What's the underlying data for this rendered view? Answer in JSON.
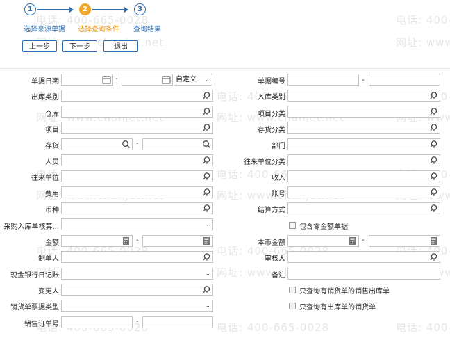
{
  "watermark": {
    "phone": "电话: 400-665-0028",
    "site": "网址: www.chanjet.net"
  },
  "wizard": {
    "steps": [
      {
        "num": "1",
        "label": "选择来源单据"
      },
      {
        "num": "2",
        "label": "选择查询条件"
      },
      {
        "num": "3",
        "label": "查询结果"
      }
    ],
    "active_step": 2
  },
  "buttons": {
    "prev": "上一步",
    "next": "下一步",
    "exit": "退出"
  },
  "form": {
    "left": {
      "doc_date": "单据日期",
      "dash": "-",
      "date_mode": "自定义",
      "out_type": "出库类别",
      "warehouse": "仓库",
      "project": "项目",
      "inventory": "存货",
      "person": "人员",
      "partner": "往来单位",
      "expense": "费用",
      "currency": "币种",
      "purchase_account": "采购入库单核算...",
      "amount": "金额",
      "maker": "制单人",
      "cash_bank": "现金银行日记账",
      "changer": "变更人",
      "sales_type": "销货单票据类型",
      "sales_order_no": "销售订单号"
    },
    "right": {
      "doc_no": "单据编号",
      "in_type": "入库类别",
      "project_class": "项目分类",
      "inventory_class": "存货分类",
      "dept": "部门",
      "partner_class": "往来单位分类",
      "income": "收入",
      "account": "账号",
      "settle": "结算方式",
      "include_zero": "包含零金额单据",
      "base_amount": "本币金额",
      "auditor": "审核人",
      "remark": "备注",
      "only_sales_out": "只查询有销货单的销售出库单",
      "only_out_sales": "只查询有出库单的销货单"
    }
  },
  "colors": {
    "accent": "#2f6db0",
    "active_step": "#f0a62a"
  }
}
